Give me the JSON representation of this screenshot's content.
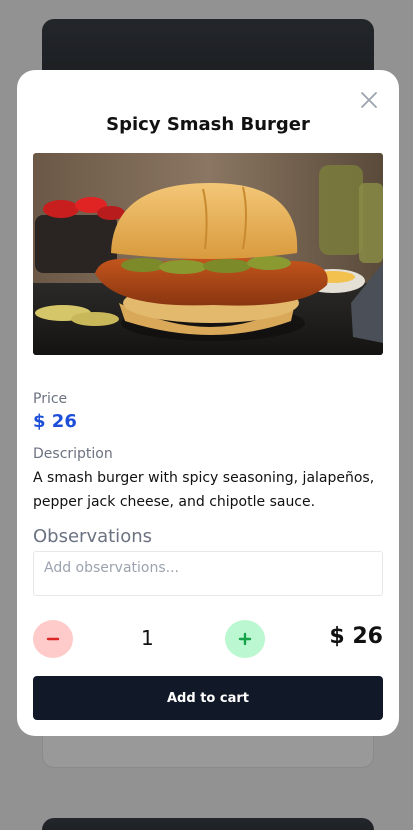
{
  "modal": {
    "title": "Spicy Smash Burger",
    "price_label": "Price",
    "price": "$ 26",
    "description_label": "Description",
    "description": "A smash burger with spicy seasoning, jalapeños, pepper jack cheese, and chipotle sauce.",
    "observations_label": "Observations",
    "observations_placeholder": "Add observations...",
    "observations_value": "",
    "quantity": "1",
    "total": "$ 26",
    "add_button_label": "Add to cart"
  },
  "icons": {
    "close": "close-icon",
    "minus": "minus-icon",
    "plus": "plus-icon"
  },
  "colors": {
    "price": "#1d4ed8",
    "minus_bg": "#fecaca",
    "minus_fg": "#dc2626",
    "plus_bg": "#bbf7d0",
    "plus_fg": "#16a34a",
    "primary_button": "#111827"
  }
}
